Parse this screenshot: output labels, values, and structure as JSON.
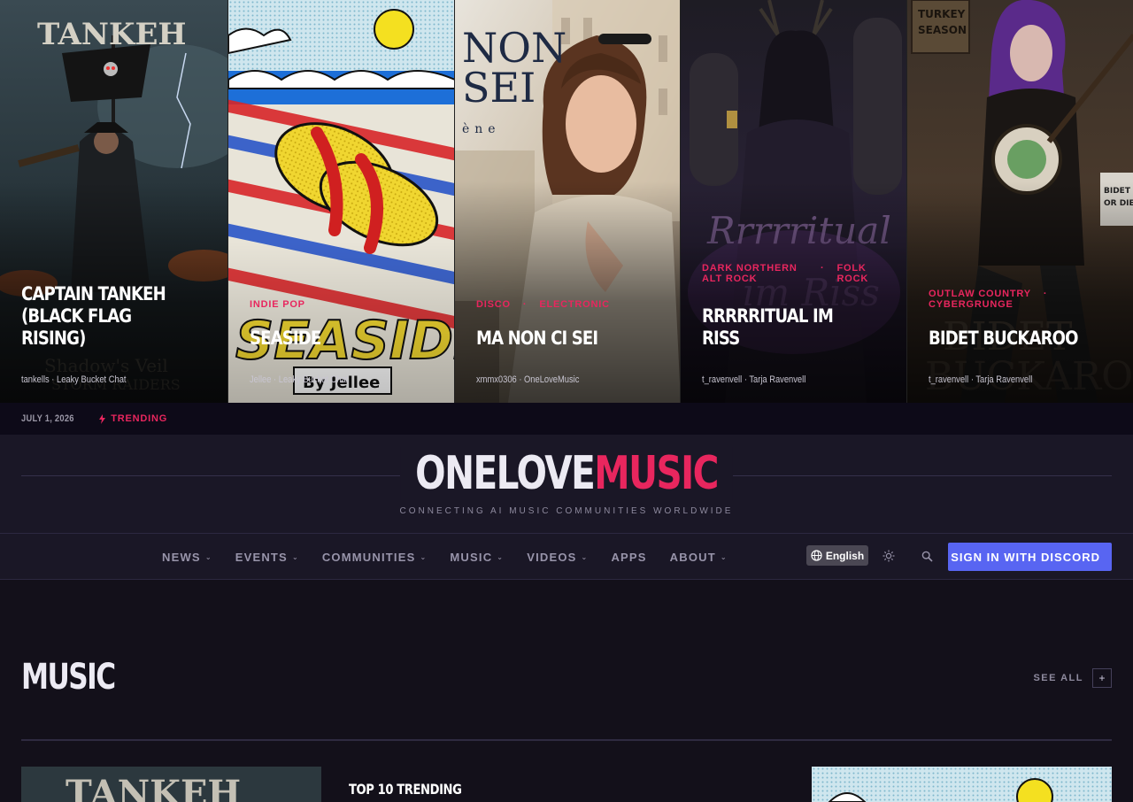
{
  "hero": {
    "cards": [
      {
        "title": "CAPTAIN TANKEH (BLACK FLAG RISING)",
        "genres": [],
        "byline": "tankells · Leaky Bucket Chat",
        "art_text": "TANKEH",
        "art_sub": "Shadow's Veil"
      },
      {
        "title": "SEASIDE",
        "genres": [
          "INDIE POP"
        ],
        "byline": "Jellee · Leaky Bucket Chat",
        "art_text": "SEASIDE",
        "art_sub": "By Jellee"
      },
      {
        "title": "MA NON CI SEI",
        "genres": [
          "DISCO",
          "ELECTRONIC"
        ],
        "byline": "xmmx0306 · OneLoveMusic",
        "art_text": "NON SEI",
        "art_sub": "ène"
      },
      {
        "title": "RRRRRITUAL IM RISS",
        "genres": [
          "DARK NORTHERN ALT ROCK",
          "FOLK ROCK"
        ],
        "byline": "t_ravenvell · Tarja Ravenvell",
        "art_text": "Rrrrrritual im Riss",
        "art_sub": ""
      },
      {
        "title": "BIDET BUCKAROO",
        "genres": [
          "OUTLAW COUNTRY",
          "CYBERGRUNGE"
        ],
        "byline": "t_ravenvell · Tarja Ravenvell",
        "art_text": "BIDET BUCKAROO",
        "art_sub": "TURKEY SEASON"
      }
    ]
  },
  "metabar": {
    "date": "JULY 1, 2026",
    "trending": "TRENDING"
  },
  "masthead": {
    "logo_a": "ONELOVE",
    "logo_b": "MUSIC",
    "tagline": "CONNECTING AI MUSIC COMMUNITIES WORLDWIDE"
  },
  "nav": {
    "items": [
      {
        "label": "NEWS",
        "has_menu": true
      },
      {
        "label": "EVENTS",
        "has_menu": true
      },
      {
        "label": "COMMUNITIES",
        "has_menu": true
      },
      {
        "label": "MUSIC",
        "has_menu": true
      },
      {
        "label": "VIDEOS",
        "has_menu": true
      },
      {
        "label": "APPS",
        "has_menu": false
      },
      {
        "label": "ABOUT",
        "has_menu": true
      }
    ],
    "language": "English",
    "signin": "SIGN IN WITH DISCORD"
  },
  "main": {
    "section_title": "MUSIC",
    "see_all": "SEE ALL",
    "top10": "TOP 10 TRENDING"
  },
  "colors": {
    "accent": "#e8265e",
    "discord": "#5865f2",
    "bg": "#13101a",
    "panel": "#1a1726"
  }
}
